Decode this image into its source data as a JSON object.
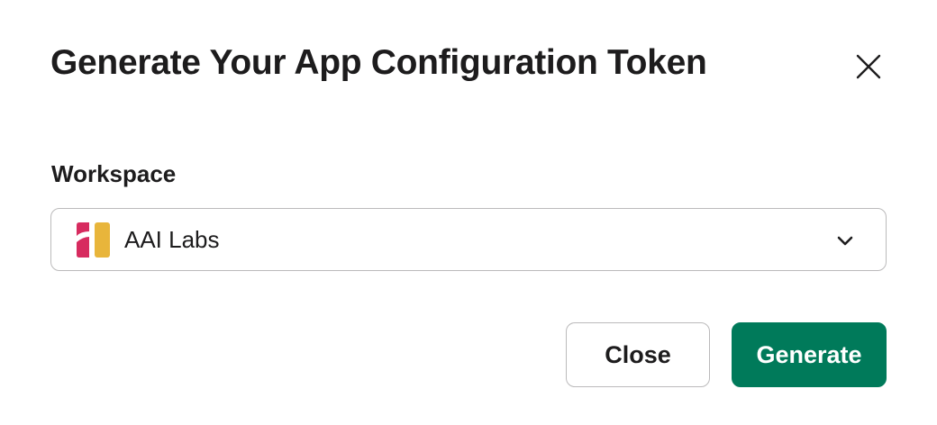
{
  "dialog": {
    "title": "Generate Your App Configuration Token",
    "close_icon": "close-icon"
  },
  "workspace_field": {
    "label": "Workspace",
    "selected_value": "AAI Labs",
    "logo_icon": "workspace-logo-icon",
    "dropdown_icon": "chevron-down-icon"
  },
  "actions": {
    "close_label": "Close",
    "generate_label": "Generate"
  },
  "colors": {
    "primary": "#007a5a",
    "text": "#1d1c1d",
    "border": "#bbbabb",
    "logo_red": "#d72b5f",
    "logo_yellow": "#e8b53b"
  }
}
